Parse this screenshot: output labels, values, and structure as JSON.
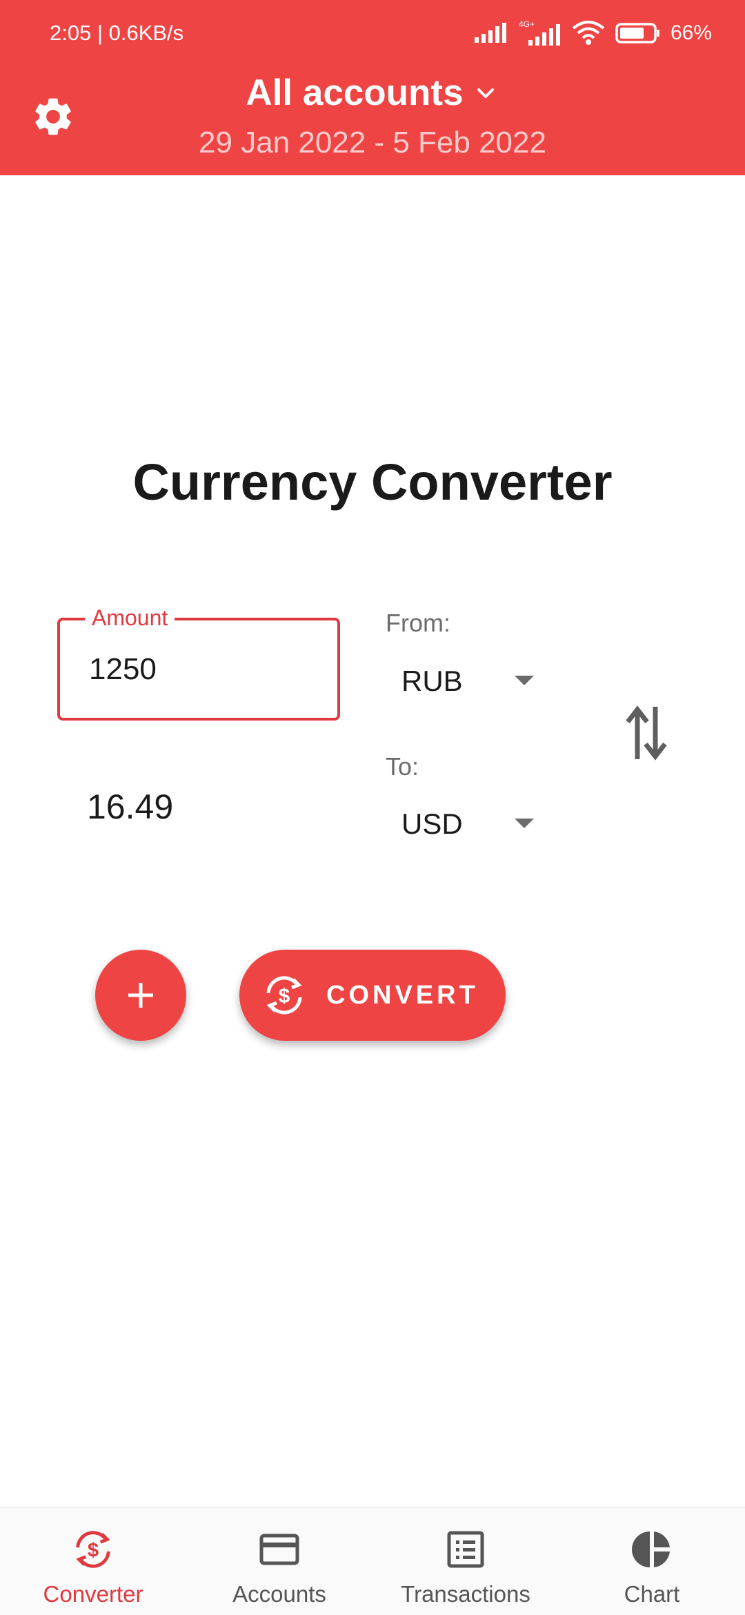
{
  "status_bar": {
    "time_speed": "2:05 | 0.6KB/s",
    "network_label": "4G+",
    "battery": "66%"
  },
  "header": {
    "title": "All accounts",
    "date_range": "29 Jan 2022 - 5 Feb 2022"
  },
  "converter": {
    "title": "Currency Converter",
    "amount_label": "Amount",
    "amount_value": "1250",
    "result_value": "16.49",
    "from_label": "From:",
    "from_currency": "RUB",
    "to_label": "To:",
    "to_currency": "USD",
    "convert_label": "CONVERT"
  },
  "bottom_nav": {
    "items": [
      {
        "label": "Converter",
        "icon": "currency-exchange-icon",
        "active": true
      },
      {
        "label": "Accounts",
        "icon": "credit-card-icon",
        "active": false
      },
      {
        "label": "Transactions",
        "icon": "list-icon",
        "active": false
      },
      {
        "label": "Chart",
        "icon": "pie-chart-icon",
        "active": false
      }
    ]
  },
  "colors": {
    "accent": "#ef4444",
    "accent_text": "#e0393e",
    "muted": "#6b6b6b"
  }
}
